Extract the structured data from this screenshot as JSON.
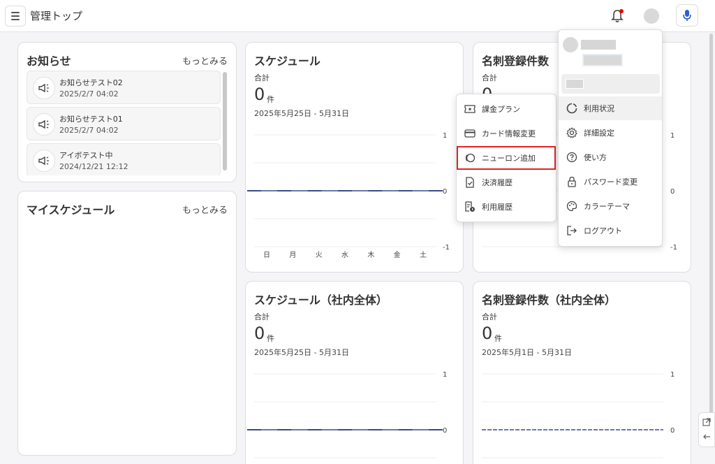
{
  "header": {
    "title": "管理トップ",
    "icons": {
      "menu": "hamburger-icon",
      "bell": "bell-icon",
      "mic": "microphone-icon"
    },
    "colors": {
      "notification_dot": "#e00000",
      "mic_accent": "#2f5fcf"
    }
  },
  "notices": {
    "title": "お知らせ",
    "more": "もっとみる",
    "items": [
      {
        "title": "お知らせテスト02",
        "date": "2025/2/7 04:02"
      },
      {
        "title": "お知らせテスト01",
        "date": "2025/2/7 04:02"
      },
      {
        "title": "アイボテスト中",
        "date": "2024/12/21 12:12"
      }
    ]
  },
  "my_schedule": {
    "title": "マイスケジュール",
    "more": "もっとみる"
  },
  "schedule": {
    "title": "スケジュール",
    "total_label": "合計",
    "count": "0",
    "unit": "件",
    "range": "2025年5月25日 - 5月31日"
  },
  "cards_count": {
    "title": "名刺登録件数",
    "total_label": "合計",
    "count": "0"
  },
  "schedule_all": {
    "title": "スケジュール（社内全体）",
    "total_label": "合計",
    "count": "0",
    "unit": "件",
    "range": "2025年5月25日 - 5月31日"
  },
  "cards_count_all": {
    "title": "名刺登録件数（社内全体）",
    "total_label": "合計",
    "count": "0",
    "unit": "件",
    "range": "2025年5月1日 - 5月31日"
  },
  "chart_data": [
    {
      "type": "line",
      "categories": [
        "日",
        "月",
        "火",
        "水",
        "木",
        "金",
        "土"
      ],
      "values": [
        0,
        0,
        0,
        0,
        0,
        0,
        0
      ],
      "ylim": [
        -1,
        1
      ],
      "yticks": [
        "1",
        "0",
        "-1"
      ],
      "color": "#3a4a8a"
    },
    {
      "type": "line",
      "yticks": [
        "1",
        "0",
        "-1"
      ],
      "ylim": [
        -1,
        1
      ]
    },
    {
      "type": "line",
      "values": [
        0,
        0,
        0,
        0,
        0,
        0,
        0
      ],
      "yticks": [
        "1",
        "0"
      ],
      "ylim": [
        -1,
        1
      ],
      "color": "#3a4a8a"
    },
    {
      "type": "line",
      "values": [
        0,
        0,
        0,
        0,
        0,
        0,
        0,
        0,
        0,
        0,
        0,
        0,
        0,
        0,
        0,
        0,
        0,
        0,
        0,
        0,
        0,
        0,
        0,
        0,
        0,
        0,
        0,
        0,
        0,
        0,
        0
      ],
      "yticks": [
        "1",
        "0"
      ],
      "ylim": [
        -1,
        1
      ],
      "color": "#3a4a8a"
    }
  ],
  "settings_menu": {
    "items": [
      {
        "label": "課金プラン",
        "icon": "ticket-icon"
      },
      {
        "label": "カード情報変更",
        "icon": "credit-card-icon"
      },
      {
        "label": "ニューロン追加",
        "icon": "neuron-icon"
      },
      {
        "label": "決済履歴",
        "icon": "receipt-check-icon"
      },
      {
        "label": "利用履歴",
        "icon": "history-doc-icon"
      }
    ],
    "highlight_color": "#e02424"
  },
  "user_menu": {
    "items": [
      {
        "label": "利用状況",
        "icon": "usage-ring-icon"
      },
      {
        "label": "詳細設定",
        "icon": "gear-icon"
      },
      {
        "label": "使い方",
        "icon": "help-icon"
      },
      {
        "label": "パスワード変更",
        "icon": "lock-icon"
      },
      {
        "label": "カラーテーマ",
        "icon": "palette-icon"
      },
      {
        "label": "ログアウト",
        "icon": "logout-icon"
      }
    ]
  }
}
